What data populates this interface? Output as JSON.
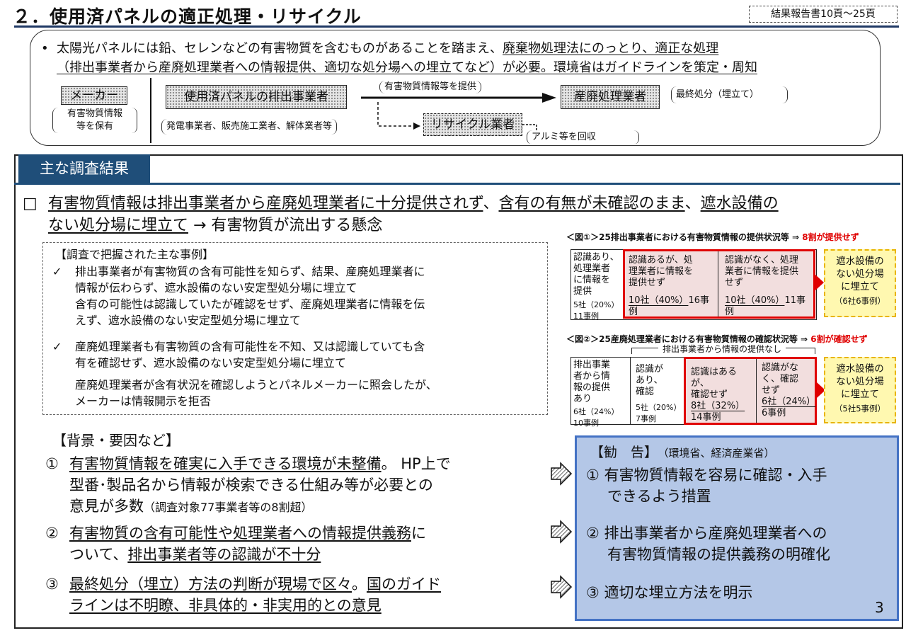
{
  "title": "２．使用済パネルの適正処理・リサイクル",
  "ref": "結果報告書10頁～25頁",
  "intro": {
    "bullet": "•",
    "line1_a": "太陽光パネルには鉛、セレンなどの有害物質を含むものがあることを踏まえ、",
    "line1_b": "廃棄物処理法にのっとり、適正な処理",
    "line2_a": "（排出事業者から産廃処理業者への情報提供、適切な処分場への埋立てなど）が必要。",
    "line2_b": "環境省はガイドラインを策定・周知"
  },
  "flow": {
    "maker": "メーカー",
    "maker_note1": "有害物質情報",
    "maker_note2": "等を保有",
    "discharger": "使用済パネルの排出事業者",
    "discharger_note": "発電事業者、販売施工業者、解体業者等",
    "arrow_label": "有害物質情報等を提供",
    "disposal": "産廃処理業者",
    "disposal_note": "最終処分（埋立て）",
    "recycler": "リサイクル業者",
    "recycler_note": "アルミ等を回収"
  },
  "section_tab": "主な調査結果",
  "finding": {
    "marker": "□",
    "l1_a": "有害物質情報は排出事業者から産廃処理業者に十分提供されず",
    "l1_b": "、",
    "l1_c": "含有の有無が未確認のまま",
    "l1_d": "、",
    "l1_e": "遮水設備の",
    "l2_a": "ない処分場に埋立て",
    "l2_b": " → 有害物質が流出する懸念"
  },
  "cases": {
    "heading": "【調査で把握された主な事例】",
    "check": "✓",
    "c1_l1": "排出事業者が有害物質の含有可能性を知らず、結果、産廃処理業者に",
    "c1_l2": "情報が伝わらず、遮水設備のない安定型処分場に埋立て",
    "c1_l3": "含有の可能性は認識していたが確認をせず、産廃処理業者に情報を伝",
    "c1_l4": "えず、遮水設備のない安定型処分場に埋立て",
    "c2_l1": "産廃処理業者も有害物質の含有可能性を不知、又は認識していても含",
    "c2_l2": "有を確認せず、遮水設備のない安定型処分場に埋立て",
    "c2_l3": "産廃処理業者が含有状況を確認しようとパネルメーカーに照会したが、",
    "c2_l4": "メーカーは情報開示を拒否"
  },
  "fig1": {
    "title": "＜図①＞25排出事業者における有害物質情報の提供状況等 ⇒ ",
    "title_red": "8割が提供せず",
    "a_l1": "認識あり、",
    "a_l2": "処理業者",
    "a_l3": "に情報を",
    "a_l4": "提供",
    "a_n1": "5社（20%）",
    "a_n2": "11事例",
    "b_l1": "認識あるが、処",
    "b_l2": "理業者に情報を",
    "b_l3": "提供せず",
    "b_n": "10社（40%）",
    "b_c": "16事例",
    "c_l1": "認識がなく、処理",
    "c_l2": "業者に情報を提供",
    "c_l3": "せず",
    "c_n": "10社（40%）",
    "c_c": "11事例",
    "y_l1": "遮水設備の",
    "y_l2": "ない処分場",
    "y_l3": "に埋立て",
    "y_n": "（6社6事例）"
  },
  "fig2": {
    "title": "＜図②＞25産廃処理業者における有害物質情報の確認状況等 ⇒ ",
    "title_red": "6割が確認せず",
    "span_label": "排出事業者から情報の提供なし",
    "a_l1": "排出事業",
    "a_l2": "者から情",
    "a_l3": "報の提供",
    "a_l4": "あり",
    "a_n1": "6社（24%）",
    "a_n2": "10事例",
    "b_l1": "認識が",
    "b_l2": "あり、",
    "b_l3": "確認",
    "b_n1": "5社（20%）",
    "b_n2": "7事例",
    "c_l1": "認識はあるが、",
    "c_l2": "確認せず",
    "c_n": "8社（32%）",
    "c_c": "14事例",
    "d_l1": "認識がな",
    "d_l2": "く、確認",
    "d_l3": "せず",
    "d_n": "6社（24%）",
    "d_c": "6事例",
    "y_l1": "遮水設備の",
    "y_l2": "ない処分場",
    "y_l3": "に埋立て",
    "y_n": "（5社5事例）"
  },
  "background": {
    "heading": "【背景・要因など】",
    "n1": "①",
    "n2": "②",
    "n3": "③",
    "b1_l1a": "有害物質情報を確実に入手できる環境が未整備",
    "b1_l1b": "。 HP上で",
    "b1_l2": "型番･製品名から情報が検索できる仕組み等が必要との",
    "b1_l3a": "意見が多数",
    "b1_l3b": "（調査対象77事業者等の8割超）",
    "b2_l1a": "有害物質の含有可能性や処理業者への情報提供義務",
    "b2_l1b": "に",
    "b2_l2a": "ついて、",
    "b2_l2b": "排出事業者等の認識が不十分",
    "b3_l1a": "最終処分（埋立）方法の判断が現場で区々",
    "b3_l1b": "。",
    "b3_l1c": "国のガイド",
    "b3_l2": "ラインは不明瞭、非具体的・非実用的との意見"
  },
  "recommend": {
    "heading": "【勧　告】",
    "heading_note": "（環境省、経済産業省）",
    "r1_l1": "① 有害物質情報を容易に確認・入手",
    "r1_l2": "できるよう措置",
    "r2_l1": "② 排出事業者から産廃処理業者への",
    "r2_l2": "有害物質情報の提供義務の明確化",
    "r3": "③ 適切な埋立方法を明示"
  },
  "page_number": "3",
  "colors": {
    "navy": "#1f4e79",
    "red": "#e00000",
    "pink": "#f2dede",
    "yellow": "#fff8b0",
    "blue": "#b4c7e7"
  }
}
